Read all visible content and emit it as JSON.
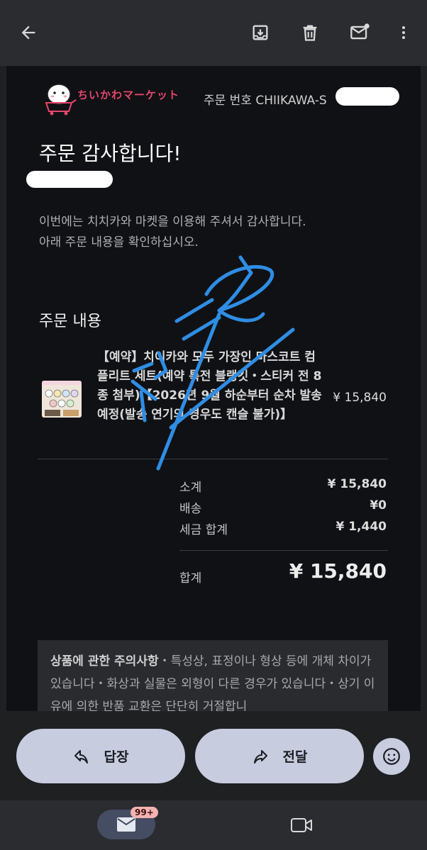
{
  "toolbar": {
    "back_icon": "arrow-back-icon",
    "archive_icon": "archive-icon",
    "delete_icon": "trash-icon",
    "unread_icon": "mark-unread-icon",
    "more_icon": "more-vert-icon"
  },
  "email": {
    "logo_text": "ちいかわマーケット",
    "order_number": "주문 번호 CHIIKAWA-S",
    "thanks_heading": "주문 감사합니다!",
    "intro_line1": "이번에는 치치카와 마켓을 이용해 주셔서 감사합니다.",
    "intro_line2": "아래 주문 내용을 확인하십시오.",
    "section_title": "주문 내용",
    "item": {
      "name": "【예약】치이카와 모두 가장인 마스코트 컴플리트 세트(예약 특전 블랭킷・스티커 전 8종 첨부)【2026년 9월 하순부터 순차 발송 예정(발송 연기의 경우도 캔슬 불가)】",
      "price": "¥ 15,840"
    },
    "summary": {
      "subtotal_label": "소계",
      "subtotal_value": "¥ 15,840",
      "shipping_label": "배송",
      "shipping_value": "¥0",
      "tax_label": "세금 합계",
      "tax_value": "¥ 1,440",
      "total_label": "합계",
      "total_value": "¥ 15,840"
    },
    "notice_title": "상품에 관한 주의사항",
    "notice_body": "・특성상, 표정이나 형상 등에 개체 차이가 있습니다・화상과 실물은 외형이 다른 경우가 있습니다・상기 이유에 의한 반품 교환은 단단히 거절합니"
  },
  "actions": {
    "reply_label": "답장",
    "forward_label": "전달",
    "emoji_icon": "emoji-icon"
  },
  "bottom_nav": {
    "mail_badge": "99+",
    "mail_icon": "mail-icon",
    "video_icon": "video-icon"
  },
  "colors": {
    "accent": "#c7ccdf",
    "scribble": "#2f8de4",
    "badge": "#f4b3b0"
  }
}
